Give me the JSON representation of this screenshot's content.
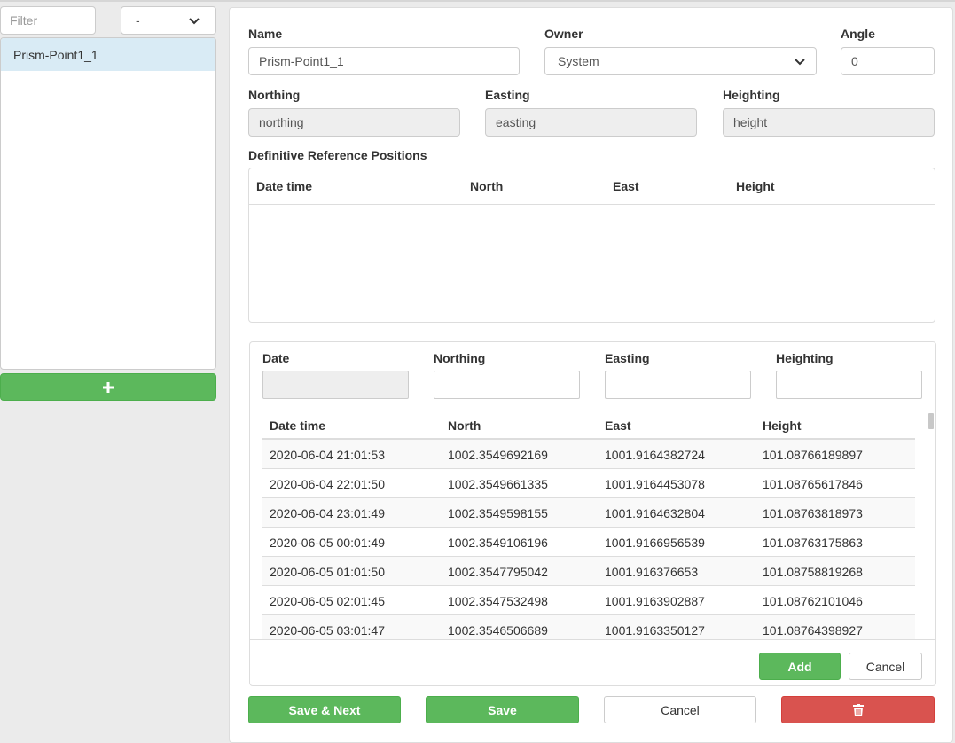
{
  "sidebar": {
    "filter_placeholder": "Filter",
    "sort_value": "-",
    "items": [
      {
        "label": "Prism-Point1_1",
        "selected": true
      }
    ],
    "add_icon": "plus-icon"
  },
  "form": {
    "name_label": "Name",
    "name_value": "Prism-Point1_1",
    "owner_label": "Owner",
    "owner_value": "System",
    "angle_label": "Angle",
    "angle_value": "0",
    "northing_label": "Northing",
    "northing_placeholder": "northing",
    "easting_label": "Easting",
    "easting_placeholder": "easting",
    "heighting_label": "Heighting",
    "heighting_placeholder": "height"
  },
  "reference": {
    "title": "Definitive Reference Positions",
    "columns": [
      "Date time",
      "North",
      "East",
      "Height"
    ]
  },
  "editor": {
    "labels": [
      "Date",
      "Northing",
      "Easting",
      "Heighting"
    ],
    "columns": [
      "Date time",
      "North",
      "East",
      "Height"
    ],
    "rows": [
      [
        "2020-06-04 21:01:53",
        "1002.3549692169",
        "1001.9164382724",
        "101.08766189897"
      ],
      [
        "2020-06-04 22:01:50",
        "1002.3549661335",
        "1001.9164453078",
        "101.08765617846"
      ],
      [
        "2020-06-04 23:01:49",
        "1002.3549598155",
        "1001.9164632804",
        "101.08763818973"
      ],
      [
        "2020-06-05 00:01:49",
        "1002.3549106196",
        "1001.9166956539",
        "101.08763175863"
      ],
      [
        "2020-06-05 01:01:50",
        "1002.3547795042",
        "1001.916376653",
        "101.08758819268"
      ],
      [
        "2020-06-05 02:01:45",
        "1002.3547532498",
        "1001.9163902887",
        "101.08762101046"
      ],
      [
        "2020-06-05 03:01:47",
        "1002.3546506689",
        "1001.9163350127",
        "101.08764398927"
      ]
    ],
    "add_label": "Add",
    "cancel_label": "Cancel"
  },
  "footer": {
    "save_next_label": "Save & Next",
    "save_label": "Save",
    "cancel_label": "Cancel",
    "delete_icon": "trash-icon"
  },
  "colors": {
    "success": "#5cb85c",
    "danger": "#d9534f",
    "selected_row": "#d9ebf5"
  }
}
